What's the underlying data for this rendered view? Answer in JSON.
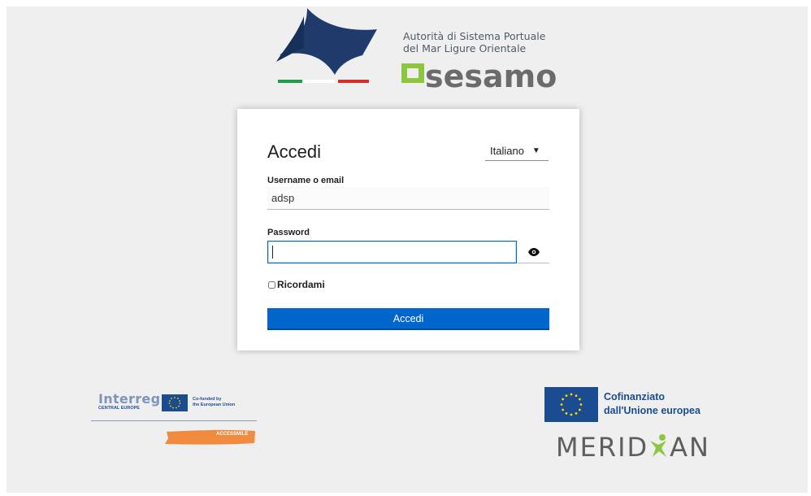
{
  "header": {
    "org_line1": "Autorità di Sistema Portuale",
    "org_line2": "del Mar Ligure Orientale",
    "brand_word": "sesamo"
  },
  "login": {
    "title": "Accedi",
    "language": {
      "selected": "Italiano",
      "icon": "caret-down-icon"
    },
    "username": {
      "label": "Username o email",
      "value": "adsp"
    },
    "password": {
      "label": "Password",
      "value": "",
      "toggle_icon": "eye-icon"
    },
    "remember_label": "Ricordami",
    "submit_label": "Accedi"
  },
  "footer": {
    "interreg_word": "Interreg",
    "interreg_sub": "CENTRAL EUROPE",
    "cofunded_line1": "Co-funded by",
    "cofunded_line2": "the European Union",
    "accessmile_word": "ACCESSMILE",
    "cofinanziato_line1": "Cofinanziato",
    "cofinanziato_line2": "dall'Unione europea",
    "meridian_left": "MERID",
    "meridian_right": "AN"
  },
  "colors": {
    "accent": "#0066cc",
    "sesamo_green": "#8dc63f",
    "eu_blue": "#1a4c8f",
    "eu_star": "#ffd700",
    "flag_green": "#1f9e4a",
    "flag_red": "#d32f2f",
    "accessmile_orange": "#f08a3e"
  }
}
